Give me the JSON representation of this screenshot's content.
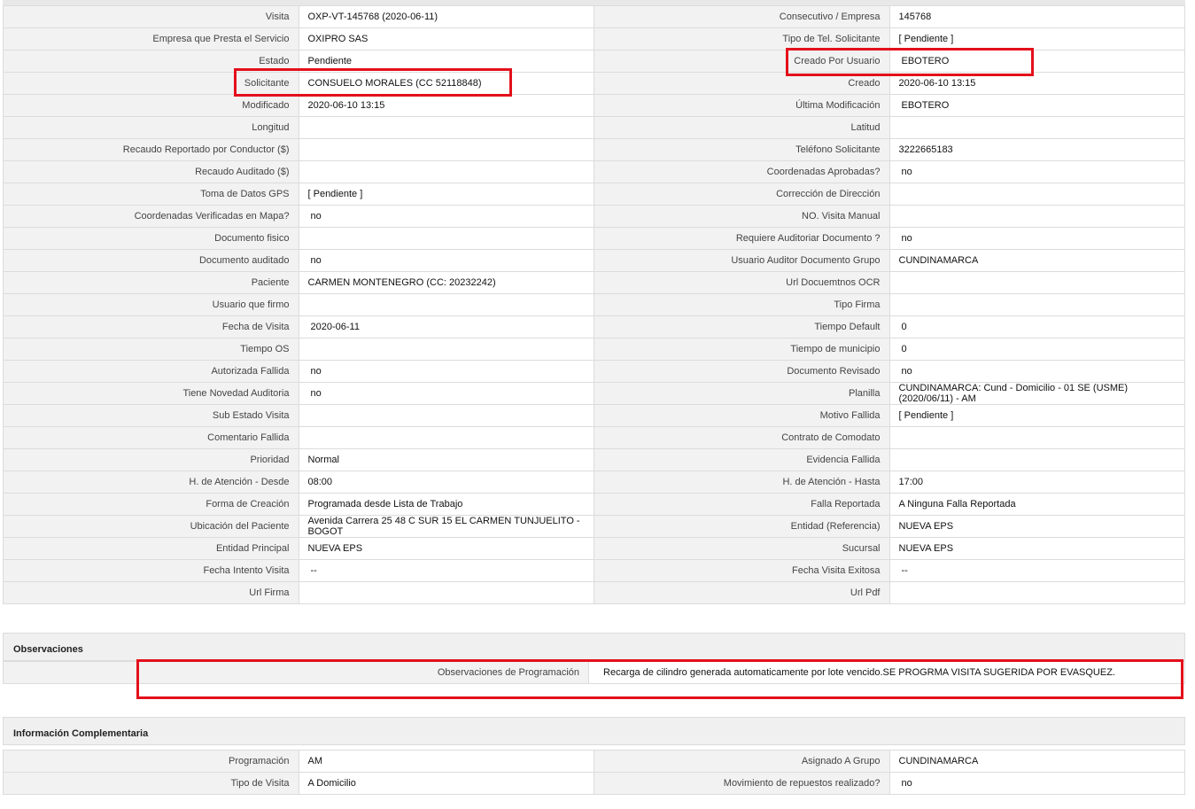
{
  "main": {
    "rows": [
      {
        "l1": "Visita",
        "v1": "OXP-VT-145768 (2020-06-11)",
        "l2": "Consecutivo / Empresa",
        "v2": "145768"
      },
      {
        "l1": "Empresa que Presta el Servicio",
        "v1": "OXIPRO SAS",
        "l2": "Tipo de Tel. Solicitante",
        "v2": "[ Pendiente ]"
      },
      {
        "l1": "Estado",
        "v1": "Pendiente",
        "l2": "Creado Por Usuario",
        "v2": "EBOTERO"
      },
      {
        "l1": "Solicitante",
        "v1": "CONSUELO MORALES (CC 52118848)",
        "l2": "Creado",
        "v2": "2020-06-10 13:15"
      },
      {
        "l1": "Modificado",
        "v1": "2020-06-10 13:15",
        "l2": "Última Modificación",
        "v2": "EBOTERO"
      },
      {
        "l1": "Longitud",
        "v1": "",
        "l2": "Latitud",
        "v2": ""
      },
      {
        "l1": "Recaudo Reportado por Conductor ($)",
        "v1": "",
        "l2": "Teléfono Solicitante",
        "v2": "3222665183"
      },
      {
        "l1": "Recaudo Auditado ($)",
        "v1": "",
        "l2": "Coordenadas Aprobadas?",
        "v2": "no"
      },
      {
        "l1": "Toma de Datos GPS",
        "v1": "[ Pendiente ]",
        "l2": "Corrección de Dirección",
        "v2": ""
      },
      {
        "l1": "Coordenadas Verificadas en Mapa?",
        "v1": "no",
        "l2": "NO. Visita Manual",
        "v2": ""
      },
      {
        "l1": "Documento fisico",
        "v1": "",
        "l2": "Requiere Auditoriar Documento ?",
        "v2": "no"
      },
      {
        "l1": "Documento auditado",
        "v1": "no",
        "l2": "Usuario Auditor Documento Grupo",
        "v2": "CUNDINAMARCA"
      },
      {
        "l1": "Paciente",
        "v1": "CARMEN MONTENEGRO (CC: 20232242)",
        "l2": "Url Docuemtnos OCR",
        "v2": ""
      },
      {
        "l1": "Usuario que firmo",
        "v1": "",
        "l2": "Tipo Firma",
        "v2": ""
      },
      {
        "l1": "Fecha de Visita",
        "v1": "2020-06-11",
        "l2": "Tiempo Default",
        "v2": "0"
      },
      {
        "l1": "Tiempo OS",
        "v1": "",
        "l2": "Tiempo de municipio",
        "v2": "0"
      },
      {
        "l1": "Autorizada Fallida",
        "v1": "no",
        "l2": "Documento Revisado",
        "v2": "no"
      },
      {
        "l1": "Tiene Novedad Auditoria",
        "v1": "no",
        "l2": "Planilla",
        "v2": "CUNDINAMARCA: Cund - Domicilio - 01 SE (USME) (2020/06/11) - AM"
      },
      {
        "l1": "Sub Estado Visita",
        "v1": "",
        "l2": "Motivo Fallida",
        "v2": "[ Pendiente ]"
      },
      {
        "l1": "Comentario Fallida",
        "v1": "",
        "l2": "Contrato de Comodato",
        "v2": ""
      },
      {
        "l1": "Prioridad",
        "v1": "Normal",
        "l2": "Evidencia Fallida",
        "v2": ""
      },
      {
        "l1": "H. de Atención - Desde",
        "v1": "08:00",
        "l2": "H. de Atención - Hasta",
        "v2": "17:00"
      },
      {
        "l1": "Forma de Creación",
        "v1": "Programada desde Lista de Trabajo",
        "l2": "Falla Reportada",
        "v2": "A Ninguna Falla Reportada"
      },
      {
        "l1": "Ubicación del Paciente",
        "v1": "Avenida Carrera 25 48 C SUR 15 EL CARMEN TUNJUELITO - BOGOT",
        "l2": "Entidad (Referencia)",
        "v2": "NUEVA EPS"
      },
      {
        "l1": "Entidad Principal",
        "v1": "NUEVA EPS",
        "l2": "Sucursal",
        "v2": "NUEVA EPS"
      },
      {
        "l1": "Fecha Intento Visita",
        "v1": "--",
        "l2": "Fecha Visita Exitosa",
        "v2": "--"
      },
      {
        "l1": "Url Firma",
        "v1": "",
        "l2": "Url Pdf",
        "v2": ""
      }
    ]
  },
  "observaciones": {
    "title": "Observaciones",
    "label": "Observaciones de Programación",
    "value": "Recarga de cilindro generada automaticamente por lote vencido.SE PROGRMA VISITA SUGERIDA POR EVASQUEZ."
  },
  "complementaria": {
    "title": "Información Complementaria",
    "rows": [
      {
        "l1": "Programación",
        "v1": "AM",
        "l2": "Asignado A Grupo",
        "v2": "CUNDINAMARCA"
      },
      {
        "l1": "Tipo de Visita",
        "v1": "A Domicilio",
        "l2": "Movimiento de repuestos realizado?",
        "v2": "no"
      }
    ]
  },
  "colors": {
    "highlight": "#e3101b",
    "label_bg": "#f2f2f2",
    "border": "#dcdcdc"
  }
}
